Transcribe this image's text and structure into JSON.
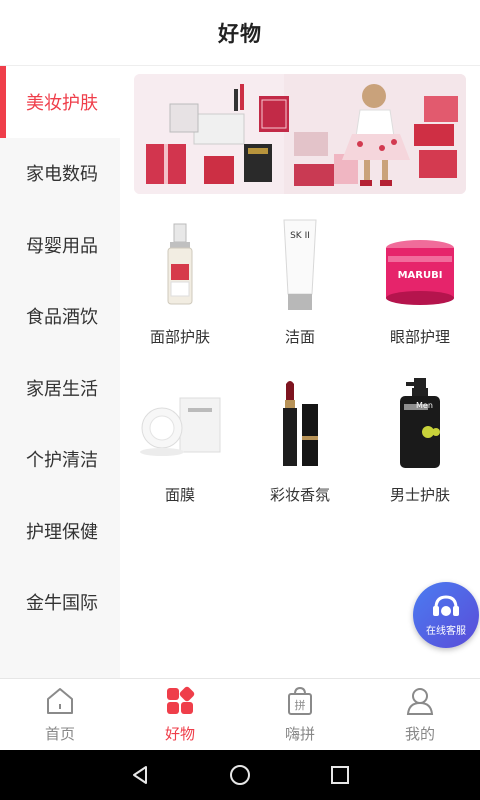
{
  "header": {
    "title": "好物"
  },
  "sidebar": {
    "items": [
      {
        "label": "美妆护肤",
        "active": true
      },
      {
        "label": "家电数码"
      },
      {
        "label": "母婴用品"
      },
      {
        "label": "食品酒饮"
      },
      {
        "label": "家居生活"
      },
      {
        "label": "个护清洁"
      },
      {
        "label": "护理保健"
      },
      {
        "label": "金牛国际"
      }
    ]
  },
  "content": {
    "categories": [
      {
        "label": "面部护肤",
        "icon": "serum-bottle-icon"
      },
      {
        "label": "洁面",
        "icon": "cleanser-tube-icon"
      },
      {
        "label": "眼部护理",
        "icon": "cream-jar-icon"
      },
      {
        "label": "面膜",
        "icon": "mask-pack-icon"
      },
      {
        "label": "彩妆香氛",
        "icon": "lipstick-icon"
      },
      {
        "label": "男士护肤",
        "icon": "men-bottle-icon"
      }
    ],
    "product_brand_text": {
      "cleanser": "SK II",
      "jar": "MARUBI",
      "men": "Men"
    }
  },
  "float_button": {
    "label": "在线客服"
  },
  "tabbar": {
    "tabs": [
      {
        "label": "首页",
        "icon": "home-icon"
      },
      {
        "label": "好物",
        "icon": "goods-icon",
        "active": true
      },
      {
        "label": "嗨拼",
        "icon": "group-buy-bag-icon",
        "badge_char": "拼"
      },
      {
        "label": "我的",
        "icon": "profile-icon"
      }
    ]
  },
  "colors": {
    "accent": "#ef3e4a",
    "sidebar_bg": "#f7f7f7",
    "cs_button": "#4f6ae8"
  }
}
